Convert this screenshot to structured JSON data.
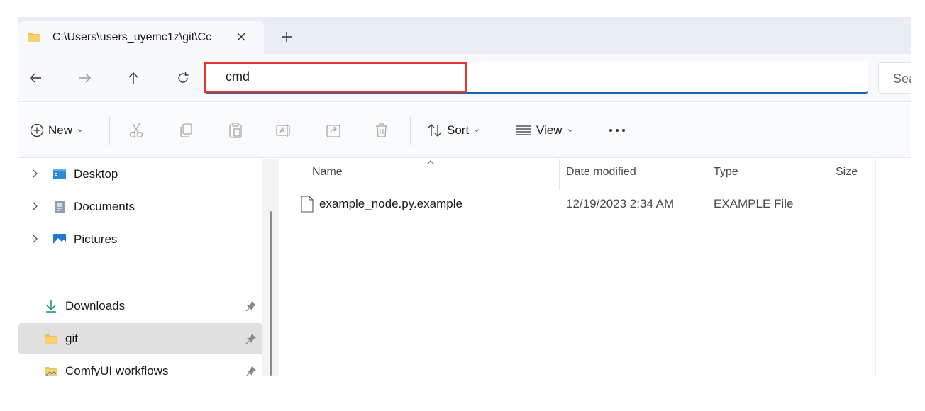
{
  "tab": {
    "title": "C:\\Users\\users_uyemc1z\\git\\Cc"
  },
  "address": {
    "value": "cmd"
  },
  "search": {
    "placeholder": "Sea"
  },
  "toolbar": {
    "new_label": "New",
    "sort_label": "Sort",
    "view_label": "View"
  },
  "nav": {
    "items": [
      {
        "label": "Desktop",
        "icon": "desktop-icon"
      },
      {
        "label": "Documents",
        "icon": "documents-icon"
      },
      {
        "label": "Pictures",
        "icon": "pictures-icon"
      }
    ],
    "quick": [
      {
        "label": "Downloads",
        "icon": "download-icon",
        "pinned": true
      },
      {
        "label": "git",
        "icon": "folder-icon",
        "pinned": true,
        "selected": true
      },
      {
        "label": "ComfyUI workflows",
        "icon": "folder-icon",
        "pinned": true
      }
    ]
  },
  "columns": {
    "name": "Name",
    "date": "Date modified",
    "type": "Type",
    "size": "Size"
  },
  "files": [
    {
      "name": "example_node.py.example",
      "date": "12/19/2023 2:34 AM",
      "type": "EXAMPLE File",
      "size": ""
    }
  ],
  "colors": {
    "accent": "#1e5fa8",
    "highlight": "#e0392b",
    "folder": "#f2c14e"
  }
}
